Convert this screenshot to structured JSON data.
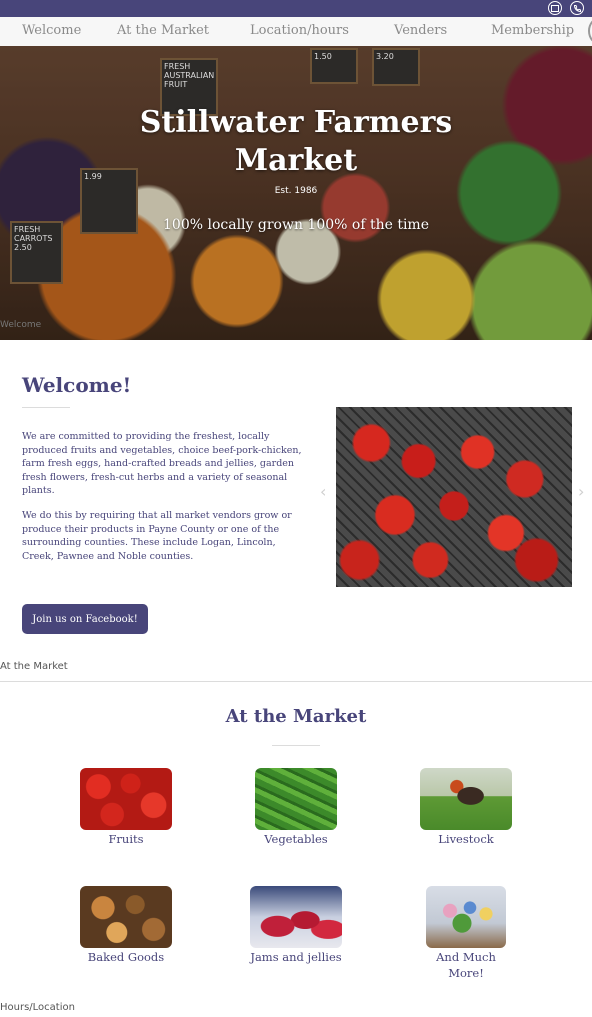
{
  "topbar": {
    "mail_icon": "mail-icon",
    "phone_icon": "phone-icon",
    "color": "#48457a"
  },
  "nav": {
    "items": [
      "Welcome",
      "At the Market",
      "Location/hours",
      "Venders",
      "Membership"
    ]
  },
  "hero": {
    "title_line1": "Stillwater Farmers",
    "title_line2": "Market",
    "established": "Est. 1986",
    "tagline": "100% locally grown 100% of the time",
    "anchor_label": "Welcome",
    "signs": [
      "FRESH",
      "AUSTRALIAN",
      "FRUIT",
      "FRESH",
      "CARROTS",
      "2.50",
      "1.50",
      "3.20",
      "1.99"
    ]
  },
  "welcome": {
    "heading": "Welcome!",
    "paragraph1": "We are committed to providing the freshest, locally produced fruits and vegetables, choice beef-pork-chicken, farm fresh eggs, hand-crafted breads and jellies, garden fresh flowers, fresh-cut herbs and a variety of seasonal plants.",
    "paragraph2": "We do this by requiring that all market vendors grow or produce their products in Payne County or one of the surrounding counties.  These include Logan, Lincoln, Creek, Pawnee and Noble counties.",
    "facebook_button": "Join us on Facebook!",
    "prev_arrow": "‹",
    "next_arrow": "›"
  },
  "market": {
    "anchor_label": "At the Market",
    "heading": "At the Market",
    "items": [
      {
        "label": "Fruits",
        "icon": "fruits-image"
      },
      {
        "label": "Vegetables",
        "icon": "vegetables-image"
      },
      {
        "label": "Livestock",
        "icon": "livestock-image"
      },
      {
        "label": "Baked Goods",
        "icon": "baked-goods-image"
      },
      {
        "label": "Jams and jellies",
        "icon": "jams-image"
      },
      {
        "label": "And Much More!",
        "icon": "flowers-image"
      }
    ]
  },
  "footer": {
    "anchor_label": "Hours/Location"
  }
}
